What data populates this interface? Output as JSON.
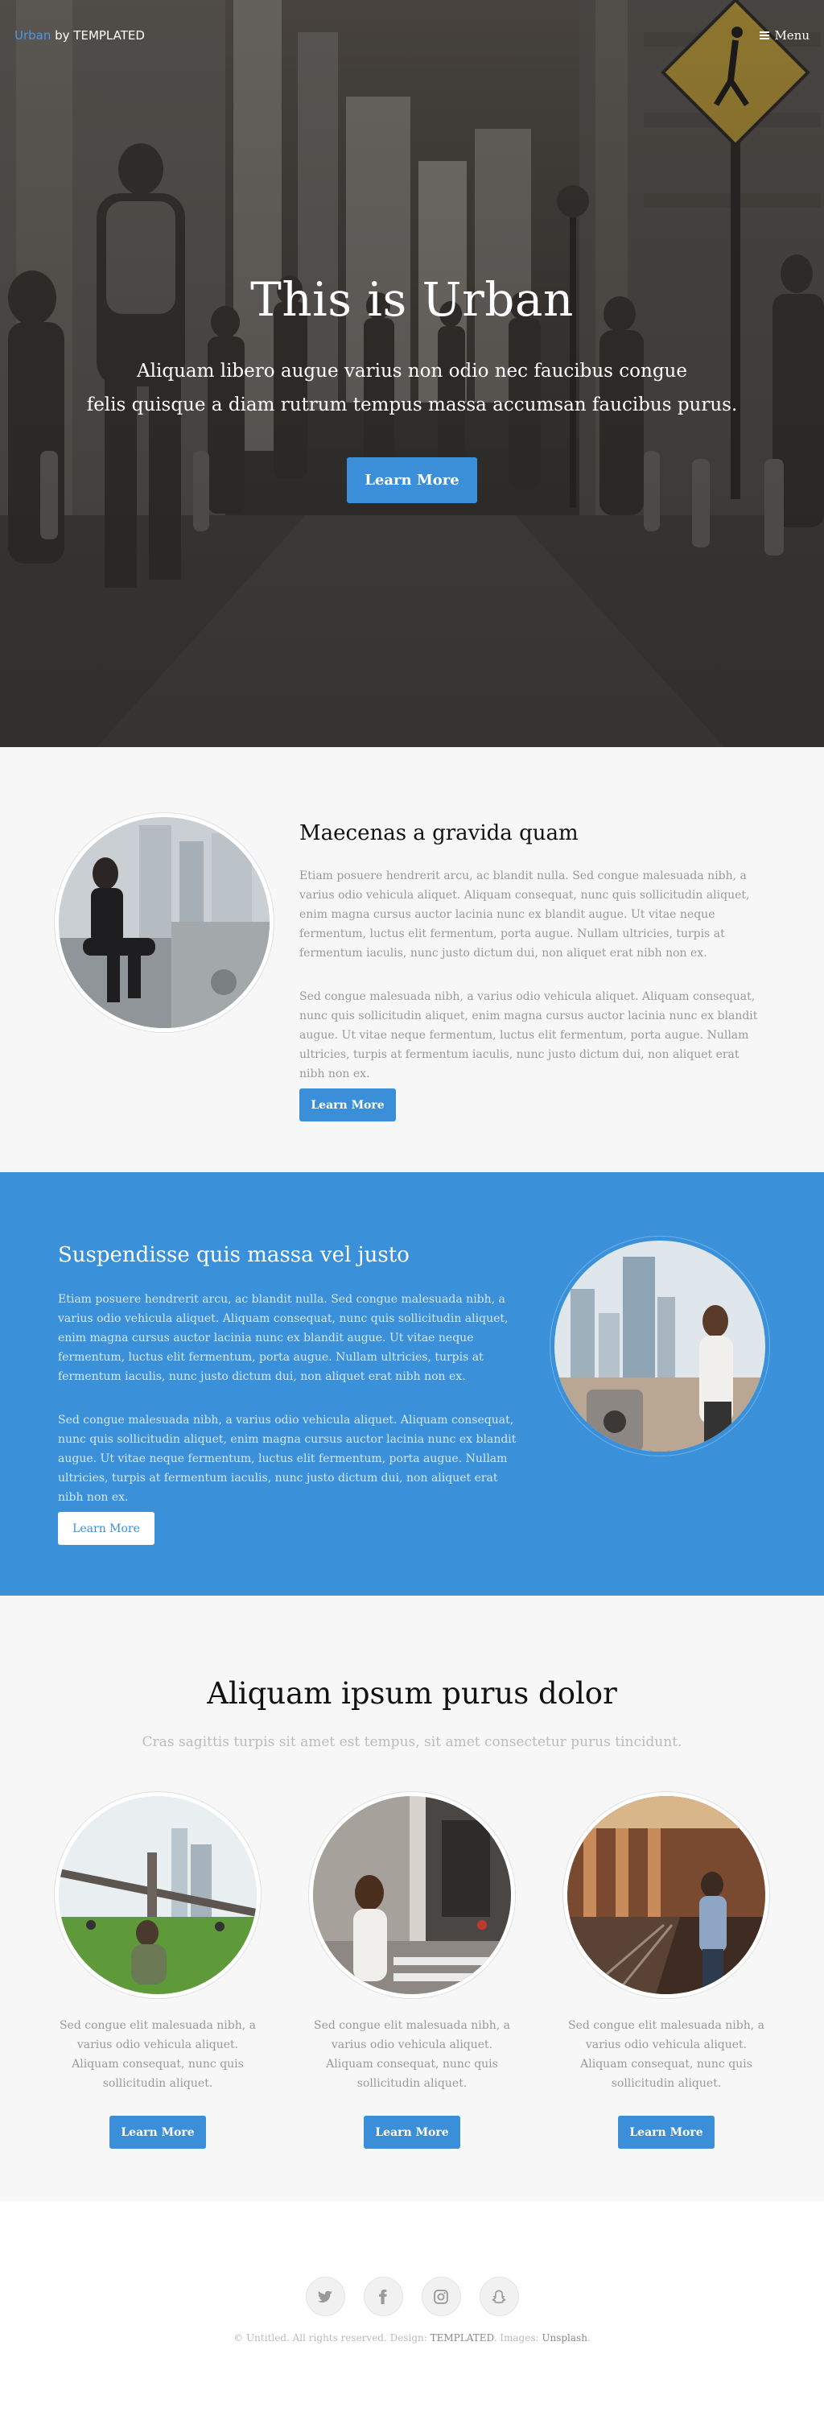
{
  "header": {
    "logo_brand": "Urban",
    "logo_by": " by TEMPLATED",
    "menu_label": "Menu"
  },
  "hero": {
    "title": "This is Urban",
    "text_line1": "Aliquam libero augue varius non odio nec faucibus congue",
    "text_line2": "felis quisque a diam rutrum tempus massa accumsan faucibus purus.",
    "button_label": "Learn More"
  },
  "section1": {
    "title": "Maecenas a gravida quam",
    "para1": "Etiam posuere hendrerit arcu, ac blandit nulla. Sed congue malesuada nibh, a varius odio vehicula aliquet. Aliquam consequat, nunc quis sollicitudin aliquet, enim magna cursus auctor lacinia nunc ex blandit augue. Ut vitae neque fermentum, luctus elit fermentum, porta augue. Nullam ultricies, turpis at fermentum iaculis, nunc justo dictum dui, non aliquet erat nibh non ex.",
    "para2": "Sed congue malesuada nibh, a varius odio vehicula aliquet. Aliquam consequat, nunc quis sollicitudin aliquet, enim magna cursus auctor lacinia nunc ex blandit augue. Ut vitae neque fermentum, luctus elit fermentum, porta augue. Nullam ultricies, turpis at fermentum iaculis, nunc justo dictum dui, non aliquet erat nibh non ex.",
    "button_label": "Learn More"
  },
  "section2": {
    "title": "Suspendisse quis massa vel justo",
    "para1": "Etiam posuere hendrerit arcu, ac blandit nulla. Sed congue malesuada nibh, a varius odio vehicula aliquet. Aliquam consequat, nunc quis sollicitudin aliquet, enim magna cursus auctor lacinia nunc ex blandit augue. Ut vitae neque fermentum, luctus elit fermentum, porta augue. Nullam ultricies, turpis at fermentum iaculis, nunc justo dictum dui, non aliquet erat nibh non ex.",
    "para2": "Sed congue malesuada nibh, a varius odio vehicula aliquet. Aliquam consequat, nunc quis sollicitudin aliquet, enim magna cursus auctor lacinia nunc ex blandit augue. Ut vitae neque fermentum, luctus elit fermentum, porta augue. Nullam ultricies, turpis at fermentum iaculis, nunc justo dictum dui, non aliquet erat nibh non ex.",
    "button_label": "Learn More"
  },
  "section3": {
    "title": "Aliquam ipsum purus dolor",
    "subtitle": "Cras sagittis turpis sit amet est tempus, sit amet consectetur purus tincidunt.",
    "cards": [
      {
        "text": "Sed congue elit malesuada nibh, a varius odio vehicula aliquet. Aliquam consequat, nunc quis sollicitudin aliquet.",
        "button_label": "Learn More"
      },
      {
        "text": "Sed congue elit malesuada nibh, a varius odio vehicula aliquet. Aliquam consequat, nunc quis sollicitudin aliquet.",
        "button_label": "Learn More"
      },
      {
        "text": "Sed congue elit malesuada nibh, a varius odio vehicula aliquet. Aliquam consequat, nunc quis sollicitudin aliquet.",
        "button_label": "Learn More"
      }
    ]
  },
  "footer": {
    "social_icons": [
      "twitter-icon",
      "facebook-icon",
      "instagram-icon",
      "snapchat-icon"
    ],
    "copyright_prefix": "© Untitled. All rights reserved. Design: ",
    "design_link": "TEMPLATED",
    "images_prefix": ". Images: ",
    "images_link": "Unsplash",
    "suffix": "."
  },
  "colors": {
    "accent": "#3a8fd8",
    "blue_section": "#3a90d9",
    "light_bg": "#f7f7f7"
  }
}
